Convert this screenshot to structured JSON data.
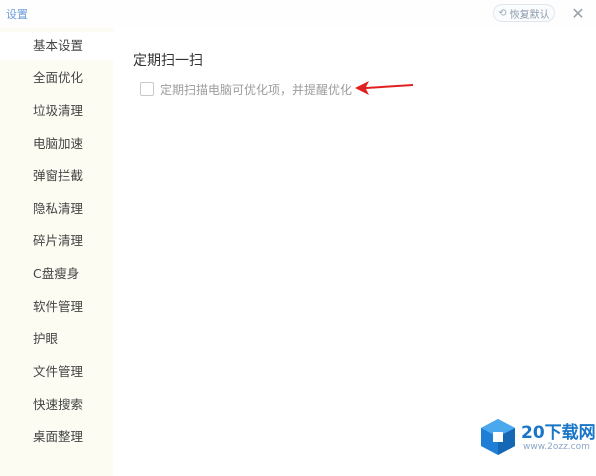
{
  "window": {
    "title": "设置",
    "restore_label": "恢复默认",
    "restore_icon": "restore-icon",
    "close_glyph": "✕",
    "close_icon": "close-icon"
  },
  "sidebar": {
    "items": [
      {
        "label": "基本设置",
        "active": true
      },
      {
        "label": "全面优化",
        "active": false
      },
      {
        "label": "垃圾清理",
        "active": false
      },
      {
        "label": "电脑加速",
        "active": false
      },
      {
        "label": "弹窗拦截",
        "active": false
      },
      {
        "label": "隐私清理",
        "active": false
      },
      {
        "label": "碎片清理",
        "active": false
      },
      {
        "label": "C盘瘦身",
        "active": false
      },
      {
        "label": "软件管理",
        "active": false
      },
      {
        "label": "护眼",
        "active": false
      },
      {
        "label": "文件管理",
        "active": false
      },
      {
        "label": "快速搜索",
        "active": false
      },
      {
        "label": "桌面整理",
        "active": false
      }
    ]
  },
  "main": {
    "section_title": "定期扫一扫",
    "option": {
      "label": "定期扫描电脑可优化项，并提醒优化",
      "checked": false
    }
  },
  "colors": {
    "accent": "#6a9bd8",
    "arrow": "#e02020",
    "sidebar_bg": "#fcfcf3",
    "watermark": "#1a76c8"
  },
  "watermark": {
    "brand": "20下载网",
    "url": "www.2ozz.com"
  }
}
